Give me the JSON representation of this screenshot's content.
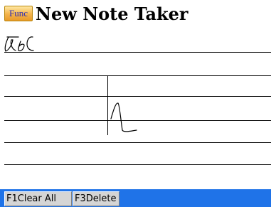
{
  "title_bar": {
    "func_label": "Func",
    "title": "New Note Taker"
  },
  "note": {
    "handwriting": "abc"
  },
  "softkeys": {
    "f1_label": "F1Clear All",
    "f3_label": "F3Delete"
  },
  "colors": {
    "softkey_bar": "#1f73e8",
    "func_button": "#f3b24a",
    "func_text": "#2e2eb5"
  }
}
